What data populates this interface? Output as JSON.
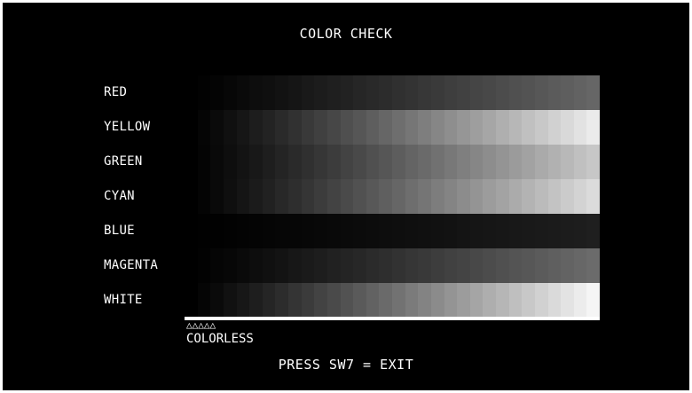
{
  "screen": {
    "title": "COLOR CHECK",
    "background": "#000000",
    "text_color": "#ffffff"
  },
  "rows": [
    {
      "label": "RED",
      "max_level": 0.4
    },
    {
      "label": "YELLOW",
      "max_level": 0.92
    },
    {
      "label": "GREEN",
      "max_level": 0.78
    },
    {
      "label": "CYAN",
      "max_level": 0.86
    },
    {
      "label": "BLUE",
      "max_level": 0.12
    },
    {
      "label": "MAGENTA",
      "max_level": 0.42
    },
    {
      "label": "WHITE",
      "max_level": 0.96
    }
  ],
  "gradient_steps": 32,
  "footer": {
    "markers": "△△△△△",
    "colorless_label": "COLORLESS",
    "exit_hint": "PRESS SW7 = EXIT"
  }
}
